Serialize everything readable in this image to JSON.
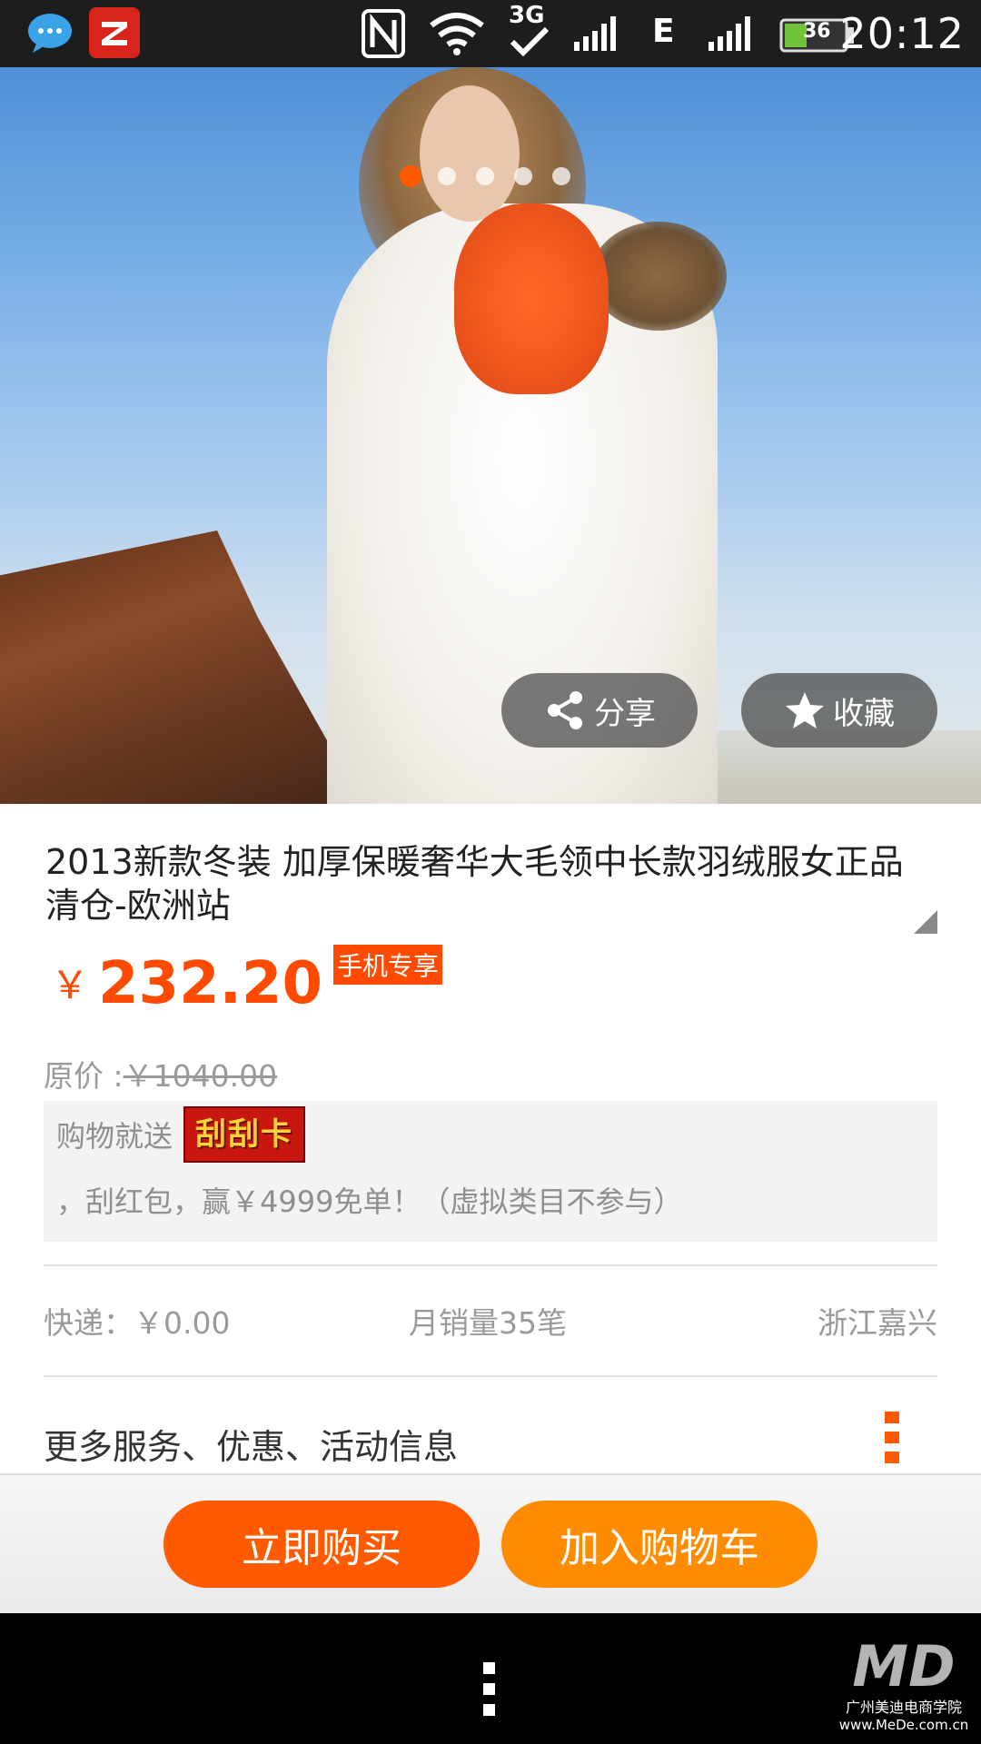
{
  "status_bar": {
    "time": "20:12",
    "network_3g": "3G",
    "network_e": "E",
    "battery": "36",
    "icons": [
      "chat-icon",
      "z-app-icon",
      "nfc-icon",
      "wifi-icon",
      "3g-icon",
      "signal-icon",
      "edge-icon",
      "signal-icon",
      "battery-icon"
    ]
  },
  "gallery": {
    "slide_count": 5,
    "active_slide": 1,
    "share_label": "分享",
    "favorite_label": "收藏"
  },
  "product": {
    "title": "2013新款冬装 加厚保暖奢华大毛领中长款羽绒服女正品清仓-欧洲站",
    "currency": "￥",
    "price": "232.20",
    "mobile_tag": "手机专享",
    "original_price_label": "原价 :",
    "original_price": "￥1040.00",
    "promo_prefix": "购物就送",
    "promo_badge": "刮刮卡",
    "promo_suffix": "，刮红包，赢￥4999免单！（虚拟类目不参与）",
    "shipping": "快递：￥0.00",
    "monthly_sales": "月销量35笔",
    "location": "浙江嘉兴",
    "more_info": "更多服务、优惠、活动信息"
  },
  "actions": {
    "buy_now": "立即购买",
    "add_to_cart": "加入购物车"
  },
  "watermark": {
    "logo": "MD",
    "line1": "广州美迪电商学院",
    "line2": "www.MeDe.com.cn"
  },
  "colors": {
    "accent": "#ff5a00",
    "cart": "#ff8c00",
    "text_muted": "#9a9a9a"
  }
}
